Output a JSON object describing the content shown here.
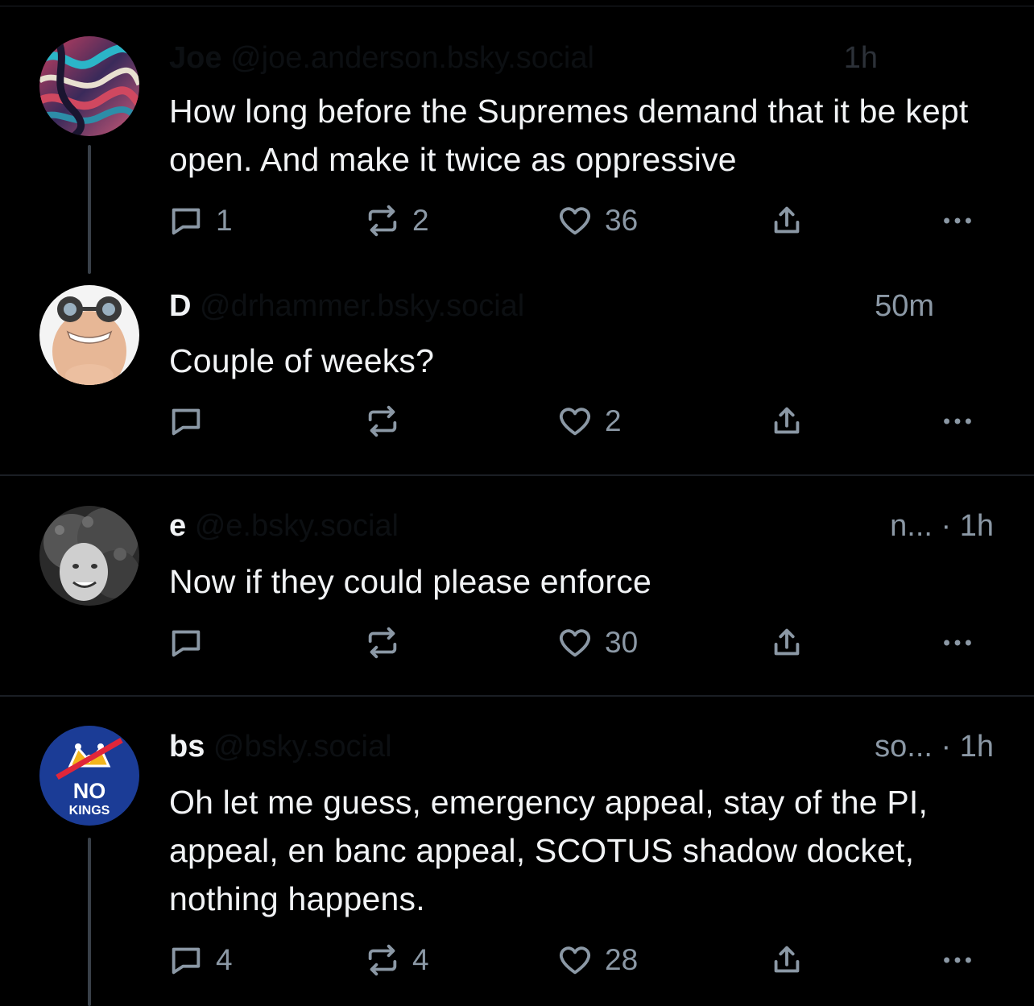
{
  "posts": [
    {
      "name": "Joe",
      "handle": "@joe.anderson.bsky.social",
      "time": "1h",
      "text": "How long before the Supremes demand that it be kept open. And make it twice as oppressive",
      "replies": "1",
      "reposts": "2",
      "likes": "36"
    },
    {
      "name": "D",
      "handle": "@drhammer.bsky.social",
      "time": "50m",
      "text": "Couple of weeks?",
      "replies": "",
      "reposts": "",
      "likes": "2"
    },
    {
      "name": "e",
      "handle": "@e.bsky.social",
      "time": "n... · 1h",
      "text": "Now if they could please enforce",
      "replies": "",
      "reposts": "",
      "likes": "30"
    },
    {
      "name": "bs",
      "handle": "@bsky.social",
      "time": "so... · 1h",
      "text": "Oh let me guess, emergency appeal, stay of the PI, appeal, en banc appeal, SCOTUS shadow docket, nothing happens.",
      "replies": "4",
      "reposts": "4",
      "likes": "28"
    }
  ],
  "avatar_badge": {
    "line1": "NO",
    "line2": "KINGS"
  },
  "icons": [
    "reply-icon",
    "repost-icon",
    "like-icon",
    "share-icon",
    "more-icon"
  ],
  "colors": {
    "background": "#000000",
    "text": "#f1f3f5",
    "muted": "#8b98a5",
    "thread_line": "#394049"
  }
}
